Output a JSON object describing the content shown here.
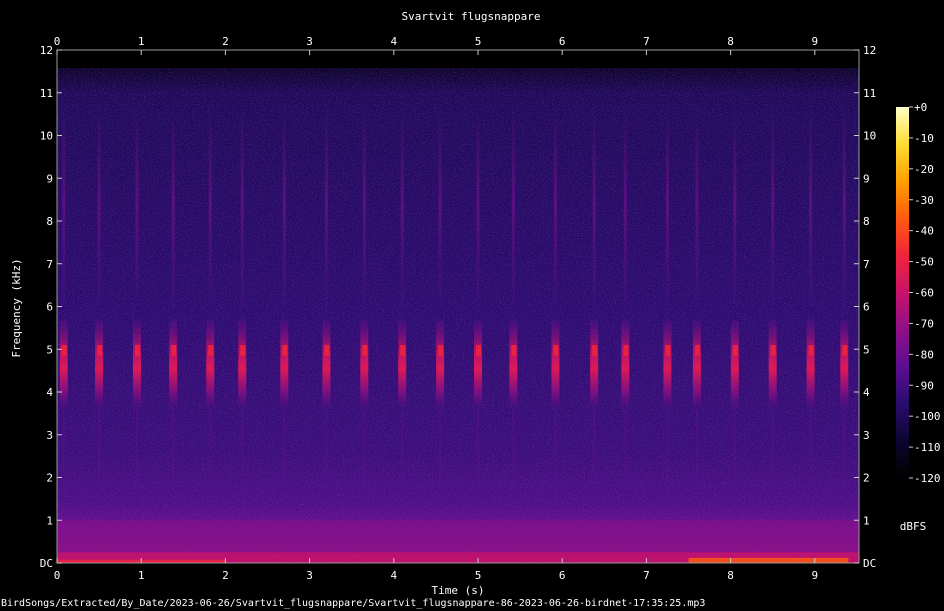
{
  "chart_data": {
    "type": "heatmap",
    "subtype": "spectrogram",
    "title": "Svartvit flugsnappare",
    "xlabel": "Time (s)",
    "ylabel": "Frequency (kHz)",
    "xlim": [
      0,
      9.5
    ],
    "ylim": [
      0,
      12
    ],
    "x_ticks": [
      "0",
      "1",
      "2",
      "3",
      "4",
      "5",
      "6",
      "7",
      "8",
      "9"
    ],
    "y_ticks": [
      "DC",
      "1",
      "2",
      "3",
      "4",
      "5",
      "6",
      "7",
      "8",
      "9",
      "10",
      "11",
      "12"
    ],
    "colorbar": {
      "label": "dBFS",
      "range": [
        -120,
        0
      ],
      "ticks": [
        "+0",
        "-10",
        "-20",
        "-30",
        "-40",
        "-50",
        "-60",
        "-70",
        "-80",
        "-90",
        "-100",
        "-110",
        "-120"
      ],
      "colors": [
        "#000000",
        "#0c0630",
        "#2a0c6e",
        "#5b0e8f",
        "#8f0f88",
        "#c8136a",
        "#f0243c",
        "#ff5a10",
        "#ffa000",
        "#ffdc30",
        "#ffffc8"
      ]
    },
    "song_notes_time_s": [
      0.08,
      0.5,
      0.95,
      1.38,
      1.82,
      2.2,
      2.7,
      3.2,
      3.65,
      4.1,
      4.55,
      5.0,
      5.42,
      5.92,
      6.38,
      6.75,
      7.25,
      7.6,
      8.05,
      8.5,
      8.95,
      9.35
    ],
    "song_band_khz": [
      3.6,
      5.7
    ],
    "low_frequency_noise_khz": [
      0,
      1.0
    ]
  },
  "footer": "BirdSongs/Extracted/By_Date/2023-06-26/Svartvit_flugsnappare/Svartvit_flugsnappare-86-2023-06-26-birdnet-17:35:25.mp3"
}
